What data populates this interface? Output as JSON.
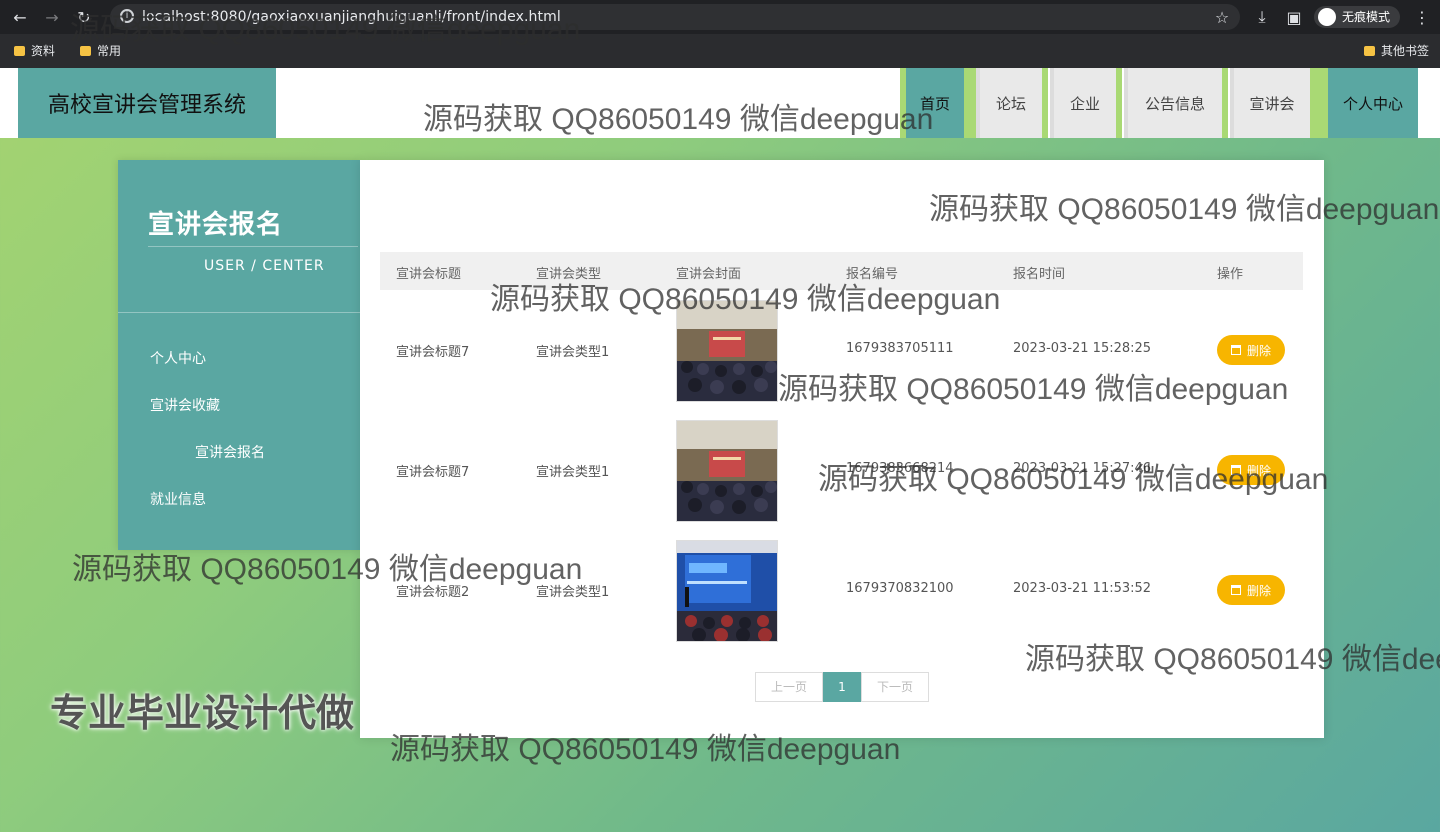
{
  "browser": {
    "url": "localhost:8080/gaoxiaoxuanjianghuiguanli/front/index.html",
    "incognito_label": "无痕模式",
    "bookmarks": [
      "资料",
      "常用"
    ],
    "other_bookmarks": "其他书签"
  },
  "header": {
    "brand": "高校宣讲会管理系统",
    "nav": [
      "首页",
      "论坛",
      "企业",
      "公告信息",
      "宣讲会",
      "个人中心"
    ]
  },
  "sidebar": {
    "title": "宣讲会报名",
    "subtitle": "USER / CENTER",
    "items": [
      "个人中心",
      "宣讲会收藏",
      "宣讲会报名",
      "就业信息"
    ]
  },
  "table": {
    "headers": [
      "宣讲会标题",
      "宣讲会类型",
      "宣讲会封面",
      "报名编号",
      "报名时间",
      "操作"
    ],
    "rows": [
      {
        "title": "宣讲会标题7",
        "type": "宣讲会类型1",
        "number": "1679383705111",
        "time": "2023-03-21 15:28:25",
        "action": "删除"
      },
      {
        "title": "宣讲会标题7",
        "type": "宣讲会类型1",
        "number": "1679383668214",
        "time": "2023-03-21 15:27:46",
        "action": "删除"
      },
      {
        "title": "宣讲会标题2",
        "type": "宣讲会类型1",
        "number": "1679370832100",
        "time": "2023-03-21 11:53:52",
        "action": "删除"
      }
    ]
  },
  "pagination": {
    "prev": "上一页",
    "current": "1",
    "next": "下一页"
  },
  "watermarks": {
    "text": "源码获取 QQ86050149 微信deepguan",
    "promo": "专业毕业设计代做"
  },
  "colors": {
    "accent": "#5aa7a2",
    "delete_button": "#f7b500"
  }
}
